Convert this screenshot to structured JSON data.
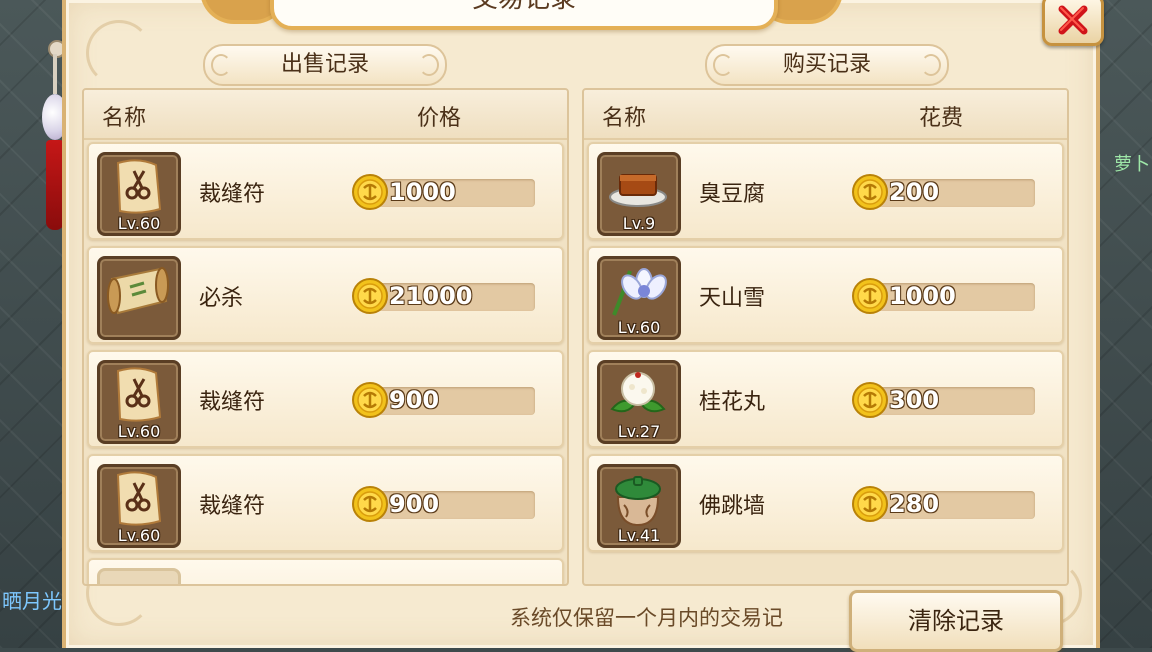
{
  "window": {
    "title": "交易记录"
  },
  "sell": {
    "section_label": "出售记录",
    "col_name": "名称",
    "col_price": "价格",
    "items": [
      {
        "name": "裁缝符",
        "level": "Lv.60",
        "price": "1000",
        "icon": "scissors-scroll-icon"
      },
      {
        "name": "必杀",
        "level": "",
        "price": "21000",
        "icon": "skill-scroll-icon"
      },
      {
        "name": "裁缝符",
        "level": "Lv.60",
        "price": "900",
        "icon": "scissors-scroll-icon"
      },
      {
        "name": "裁缝符",
        "level": "Lv.60",
        "price": "900",
        "icon": "scissors-scroll-icon"
      }
    ]
  },
  "buy": {
    "section_label": "购买记录",
    "col_name": "名称",
    "col_cost": "花费",
    "items": [
      {
        "name": "臭豆腐",
        "level": "Lv.9",
        "price": "200",
        "icon": "tofu-dish-icon"
      },
      {
        "name": "天山雪",
        "level": "Lv.60",
        "price": "1000",
        "icon": "snow-lotus-icon"
      },
      {
        "name": "桂花丸",
        "level": "Lv.27",
        "price": "300",
        "icon": "osmanthus-pill-icon"
      },
      {
        "name": "佛跳墙",
        "level": "Lv.41",
        "price": "280",
        "icon": "jar-dish-icon"
      }
    ]
  },
  "footer": {
    "note": "系统仅保留一个月内的交易记",
    "clear_button": "清除记录"
  },
  "background": {
    "left_text": "晒月光",
    "right_text": "萝卜"
  },
  "colors": {
    "panel_bg": "#f6ead0",
    "frame_gold": "#e4b056",
    "close_red": "#d0141a",
    "coin_gold": "#f2c21b"
  }
}
